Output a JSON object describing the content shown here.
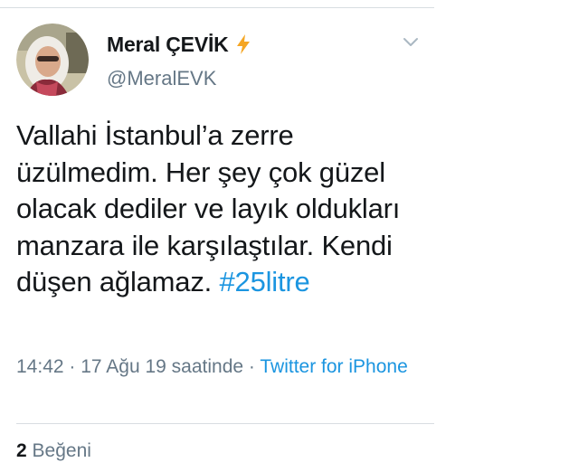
{
  "user": {
    "display_name": "Meral ÇEVİK",
    "handle": "@MeralEVK",
    "name_badge_icon": "lightning-bolt-icon",
    "badge_color": "#f5a623"
  },
  "tweet": {
    "text": "Vallahi İstanbul’a zerre üzülmedim. Her şey çok güzel olacak dediler ve layık oldukları manzara ile karşılaştılar. Kendi düşen ağlamaz. ",
    "hashtag": "#25litre"
  },
  "meta": {
    "time": "14:42",
    "separator": " · ",
    "date": "17 Ağu 19 saatinde",
    "source": "Twitter for iPhone"
  },
  "stats": {
    "likes_count": "2",
    "likes_label": "Beğeni"
  },
  "colors": {
    "link": "#1b95e0",
    "secondary_text": "#657786",
    "primary_text": "#14171a",
    "divider": "#d8dde1"
  },
  "icons": {
    "menu": "chevron-down-icon"
  }
}
